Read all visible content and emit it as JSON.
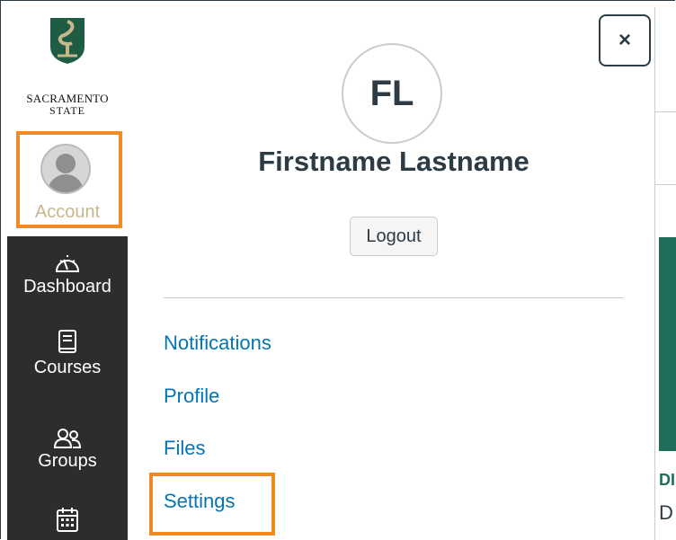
{
  "logo": {
    "line1": "SACRAMENTO",
    "line2": "STATE"
  },
  "global_nav": {
    "account_label": "Account",
    "items": [
      {
        "label": "Dashboard",
        "icon": "dashboard-icon"
      },
      {
        "label": "Courses",
        "icon": "courses-icon"
      },
      {
        "label": "Groups",
        "icon": "groups-icon"
      },
      {
        "label": "",
        "icon": "calendar-icon"
      }
    ]
  },
  "tray": {
    "close_label": "×",
    "initials": "FL",
    "user_name": "Firstname Lastname",
    "logout_label": "Logout",
    "links": [
      "Notifications",
      "Profile",
      "Files",
      "Settings"
    ]
  },
  "background_page": {
    "heading_fragment": "DI",
    "text_fragment": "D"
  },
  "colors": {
    "nav_bg": "#2d2d2d",
    "link": "#0374b5",
    "highlight": "#f08a24",
    "brand_green": "#1e6e5b"
  }
}
